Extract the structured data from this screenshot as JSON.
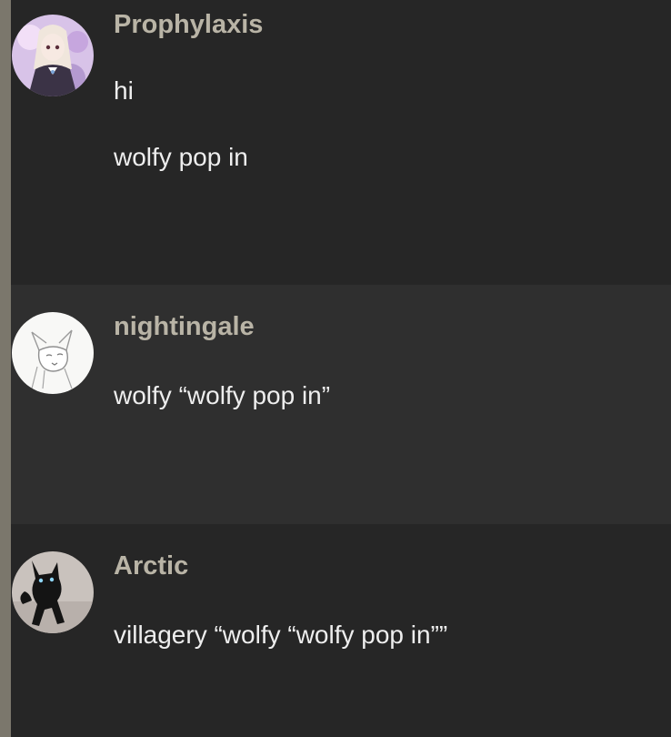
{
  "posts": [
    {
      "username": "Prophylaxis",
      "avatar": "anime-girl-avatar",
      "lines": [
        "hi",
        "wolfy pop in"
      ]
    },
    {
      "username": "nightingale",
      "avatar": "white-wolf-sketch-avatar",
      "lines": [
        "wolfy “wolfy pop in”"
      ]
    },
    {
      "username": "Arctic",
      "avatar": "black-cat-avatar",
      "lines": [
        "villagery “wolfy “wolfy pop in””"
      ]
    }
  ],
  "colors": {
    "background": "#262626",
    "alt_background": "#2f2f2f",
    "username": "#b9b4a6",
    "text": "#eeeeee",
    "rail": "#7b776c"
  }
}
